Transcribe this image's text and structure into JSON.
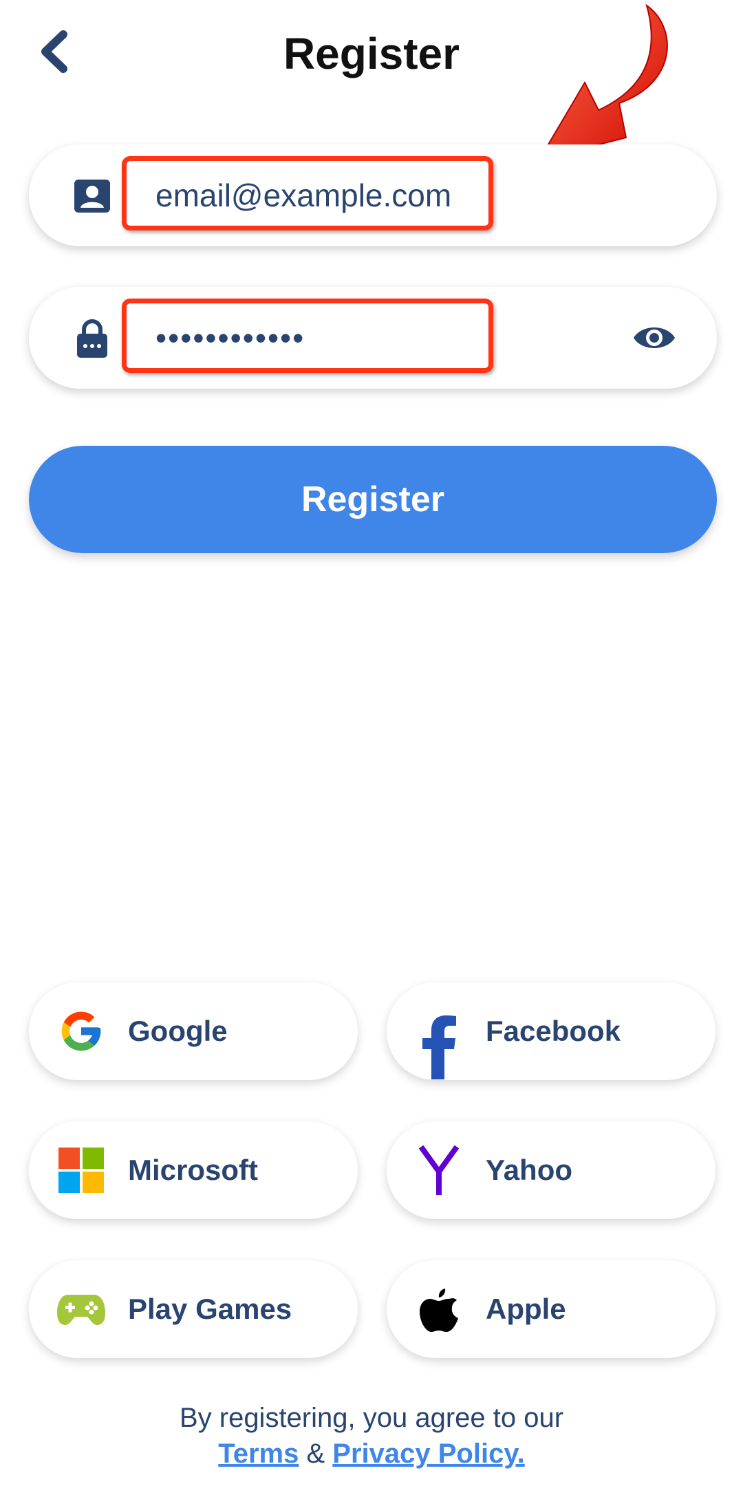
{
  "header": {
    "title": "Register",
    "back_icon": "chevron-left-icon"
  },
  "form": {
    "email": {
      "value": "email@example.com",
      "icon": "account-box-icon"
    },
    "password": {
      "value": "••••••••••••",
      "icon": "lock-icon",
      "toggle_icon": "eye-icon"
    },
    "submit_label": "Register"
  },
  "social": [
    {
      "label": "Google",
      "icon": "google-icon"
    },
    {
      "label": "Facebook",
      "icon": "facebook-icon"
    },
    {
      "label": "Microsoft",
      "icon": "microsoft-icon"
    },
    {
      "label": "Yahoo",
      "icon": "yahoo-icon"
    },
    {
      "label": "Play Games",
      "icon": "play-games-icon"
    },
    {
      "label": "Apple",
      "icon": "apple-icon"
    }
  ],
  "footer": {
    "text": "By registering, you agree to our",
    "terms": "Terms",
    "amp": "&",
    "privacy": "Privacy Policy."
  },
  "colors": {
    "primary": "#3f86e8",
    "text": "#2a4470",
    "highlight": "#ff3414",
    "title": "#111111"
  }
}
